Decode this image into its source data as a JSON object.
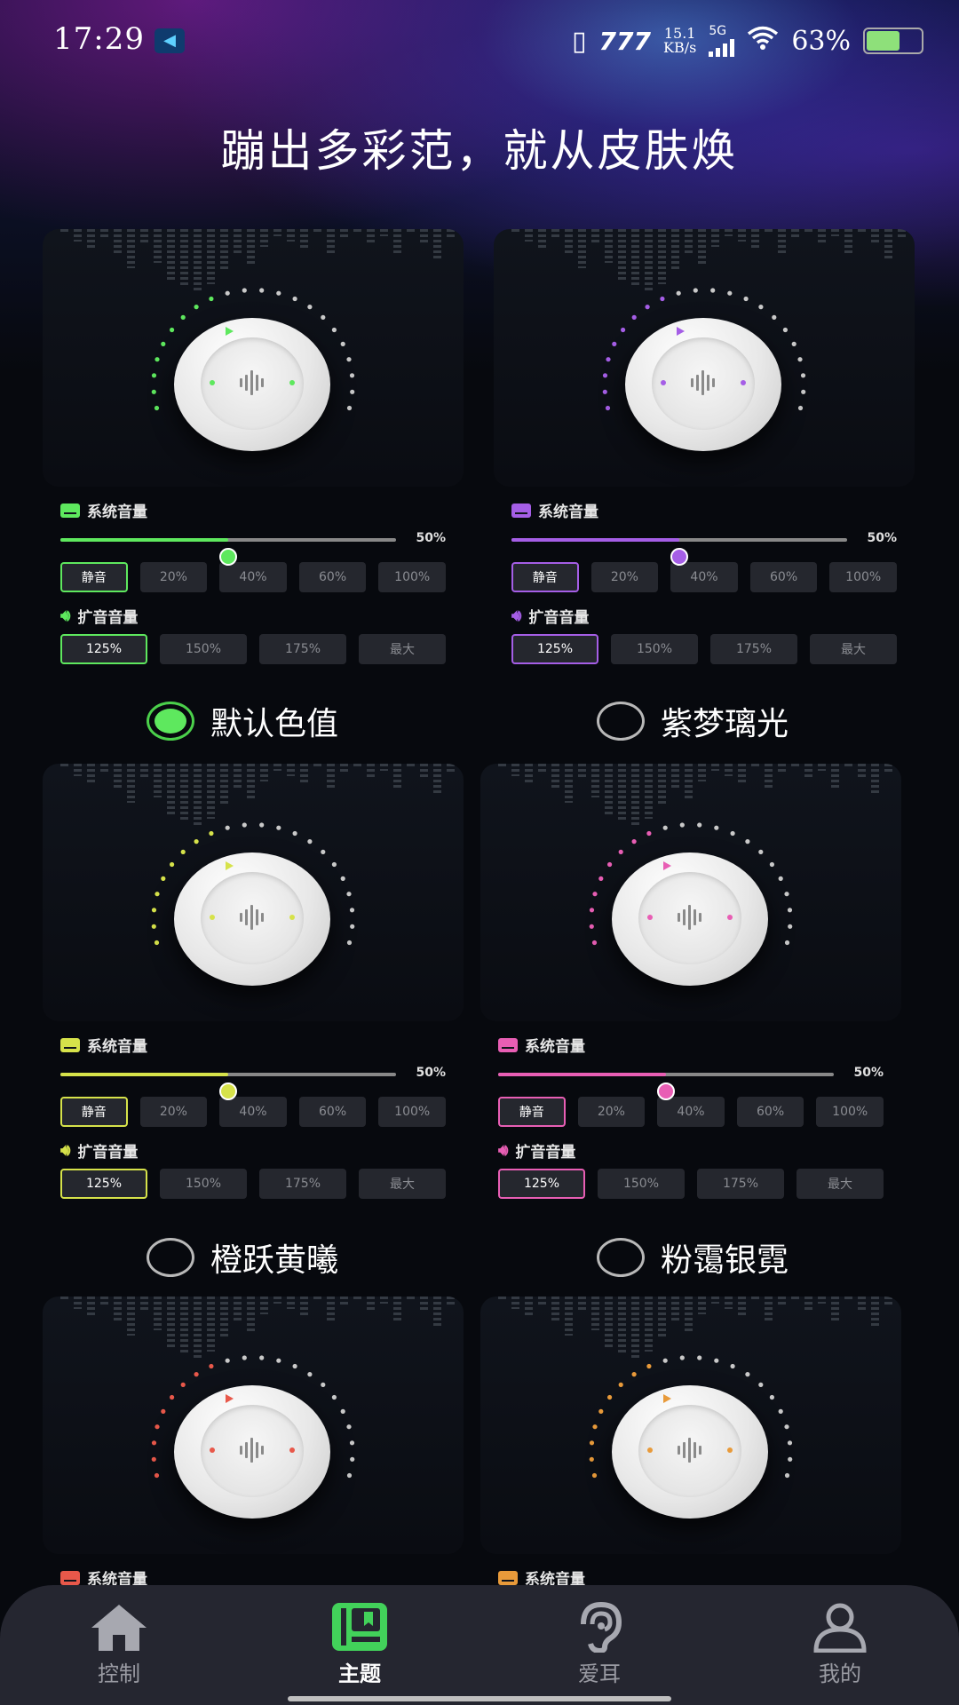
{
  "status_bar": {
    "time": "17:29",
    "network_speed_value": "15.1",
    "network_speed_unit": "KB/s",
    "signal_label": "5G",
    "battery_percent": "63%",
    "battery_level": 0.63
  },
  "headline": "蹦出多彩范，就从皮肤焕",
  "labels": {
    "system_volume": "系统音量",
    "boost_volume": "扩音音量"
  },
  "system_volume_options": [
    "静音",
    "20%",
    "40%",
    "60%",
    "100%"
  ],
  "boost_volume_options": [
    "125%",
    "150%",
    "175%",
    "最大"
  ],
  "themes": [
    {
      "name": "默认色值",
      "selected": true,
      "accent": "#5ee85e",
      "slider_value": 0.5,
      "slider_pct": "50%"
    },
    {
      "name": "紫梦璃光",
      "selected": false,
      "accent": "#a55ee6",
      "slider_value": 0.5,
      "slider_pct": "50%"
    },
    {
      "name": "橙跃黄曦",
      "selected": false,
      "accent": "#d6e24a",
      "slider_value": 0.5,
      "slider_pct": "50%"
    },
    {
      "name": "粉霭银霓",
      "selected": false,
      "accent": "#e85eb4",
      "slider_value": 0.5,
      "slider_pct": "50%"
    },
    {
      "name": "",
      "selected": false,
      "accent": "#e8584a"
    },
    {
      "name": "",
      "selected": false,
      "accent": "#e89a3a"
    }
  ],
  "bottom_nav": [
    {
      "label": "控制",
      "icon": "home-icon",
      "active": false
    },
    {
      "label": "主题",
      "icon": "theme-book-icon",
      "active": true
    },
    {
      "label": "爱耳",
      "icon": "ear-icon",
      "active": false
    },
    {
      "label": "我的",
      "icon": "user-icon",
      "active": false
    }
  ]
}
